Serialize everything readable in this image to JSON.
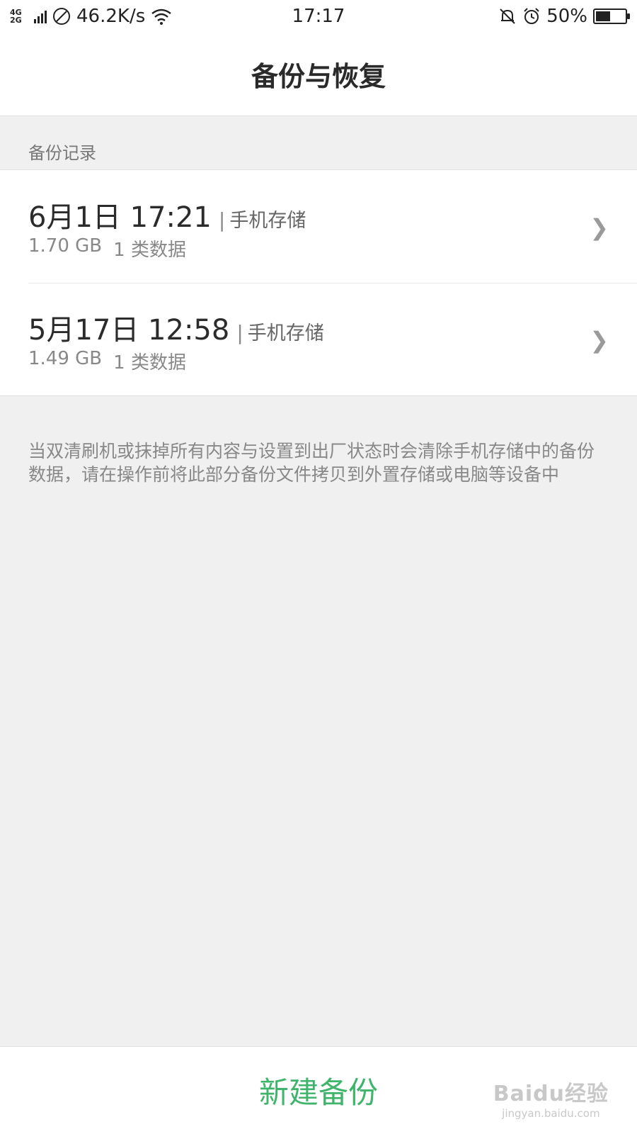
{
  "status_bar": {
    "network_type": "4G\n2G",
    "speed": "46.2K/s",
    "time": "17:17",
    "battery_percent": "50%",
    "battery_level": 0.5,
    "icons": [
      "signal-icon",
      "no-sim-icon",
      "wifi-icon",
      "mute-bell-icon",
      "alarm-icon",
      "battery-icon"
    ]
  },
  "header": {
    "title": "备份与恢复"
  },
  "section": {
    "label": "备份记录"
  },
  "backups": [
    {
      "date": "6月1日 17:21",
      "separator": "|",
      "storage": "手机存储",
      "size": "1.70 GB",
      "types": "1 类数据"
    },
    {
      "date": "5月17日 12:58",
      "separator": "|",
      "storage": "手机存储",
      "size": "1.49 GB",
      "types": "1 类数据"
    }
  ],
  "note": {
    "text": "当双清刷机或抹掉所有内容与设置到出厂状态时会清除手机存储中的备份数据，请在操作前将此部分备份文件拷贝到外置存储或电脑等设备中"
  },
  "footer": {
    "new_backup_label": "新建备份"
  },
  "watermark": {
    "logo": "Baidu经验",
    "url": "jingyan.baidu.com"
  },
  "colors": {
    "accent": "#3fb46a",
    "background": "#f0f0f0"
  }
}
